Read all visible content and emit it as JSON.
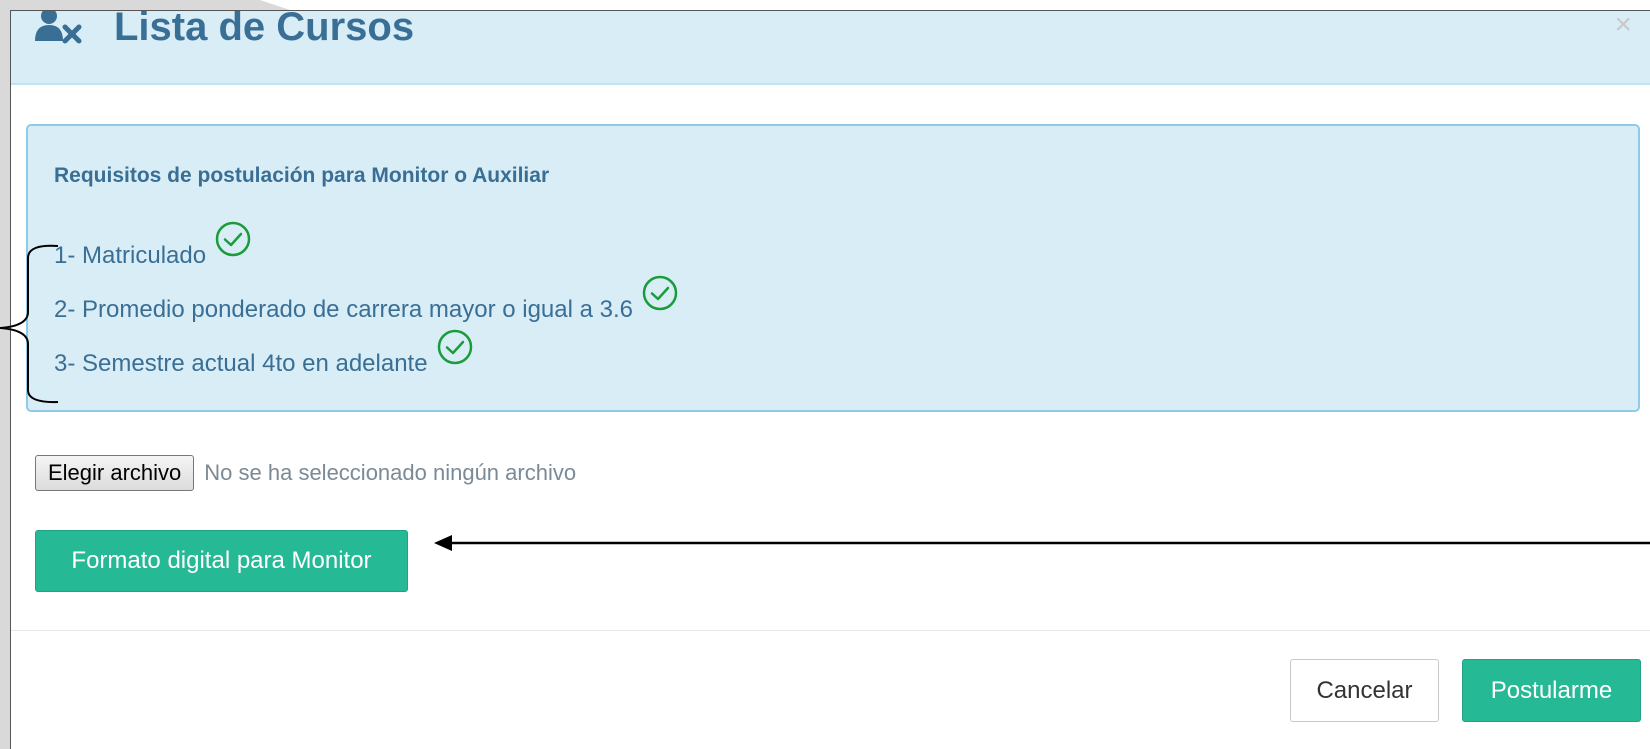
{
  "modal": {
    "title": "Lista de Cursos",
    "close_label": "×",
    "icons": {
      "header": "user-times-icon",
      "close": "close-icon",
      "check": "check-circle-icon"
    }
  },
  "requirements": {
    "heading": "Requisitos de postulación para Monitor o Auxiliar",
    "items": [
      {
        "label": "1- Matriculado",
        "met": true
      },
      {
        "label": "2- Promedio ponderado de carrera mayor o igual a 3.6",
        "met": true
      },
      {
        "label": "3- Semestre actual 4to en adelante",
        "met": true
      }
    ]
  },
  "file_upload": {
    "button_label": "Elegir archivo",
    "status": "No se ha seleccionado ningún archivo"
  },
  "format_button": {
    "label": "Formato digital para Monitor"
  },
  "footer": {
    "cancel_label": "Cancelar",
    "apply_label": "Postularme"
  },
  "colors": {
    "header_bg": "#d9edf7",
    "title": "#3a6f95",
    "accent_green": "#26b996",
    "check_green": "#1a9c3a"
  }
}
